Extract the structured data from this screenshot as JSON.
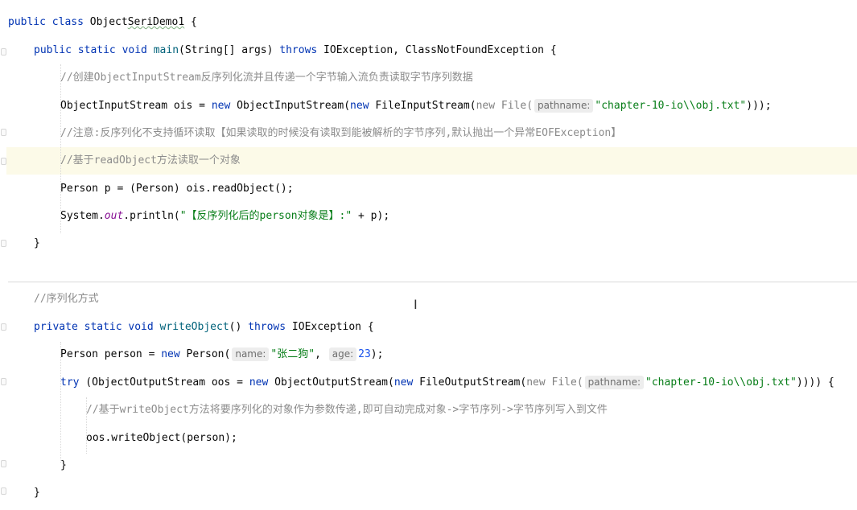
{
  "code": {
    "l1": {
      "kw": "public class ",
      "name_a": "Object",
      "name_b": "SeriDemo1",
      "tail": " {"
    },
    "l2": {
      "kw1": "public static void ",
      "name": "main",
      "p1": "(String[] args) ",
      "kw2": "throws",
      "p2": " IOException, ClassNotFoundException {"
    },
    "l3": "//创建ObjectInputStream反序列化流并且传递一个字节输入流负责读取字节序列数据",
    "l4": {
      "a": "ObjectInputStream ois = ",
      "kw1": "new",
      "b": " ObjectInputStream(",
      "kw2": "new",
      "c": " FileInputStream(",
      "g": "new File(",
      "hint": "pathname:",
      "str": "\"chapter-10-io\\\\obj.txt\"",
      "d": ")));"
    },
    "l5": "//注意:反序列化不支持循环读取【如果读取的时候没有读取到能被解析的字节序列,默认抛出一个异常EOFException】",
    "l6": "//基于readObject方法读取一个对象",
    "l7": "Person p = (Person) ois.readObject();",
    "l8": {
      "a": "System.",
      "fld": "out",
      "b": ".println(",
      "str": "\"【反序列化后的person对象是】:\"",
      "c": " + p);"
    },
    "l9": "}",
    "l10": "//序列化方式",
    "l11": {
      "kw1": "private static void ",
      "name": "writeObject",
      "a": "() ",
      "kw2": "throws",
      "b": " IOException {"
    },
    "l12": {
      "a": "Person person = ",
      "kw": "new",
      "b": " Person(",
      "hint1": "name:",
      "str1": "\"张二狗\"",
      "c": ", ",
      "hint2": "age:",
      "num": "23",
      "d": ");"
    },
    "l13": {
      "kw1": "try",
      "a": " (ObjectOutputStream oos = ",
      "kw2": "new",
      "b": " ObjectOutputStream(",
      "kw3": "new",
      "c": " FileOutputStream(",
      "g": "new File(",
      "hint": "pathname:",
      "str": "\"chapter-10-io\\\\obj.txt\"",
      "d": ")))) {"
    },
    "l14": "//基于writeObject方法将要序列化的对象作为参数传递,即可自动完成对象->字节序列->字节序列写入到文件",
    "l15": "oos.writeObject(person);",
    "l16": "}",
    "l17": "}"
  }
}
